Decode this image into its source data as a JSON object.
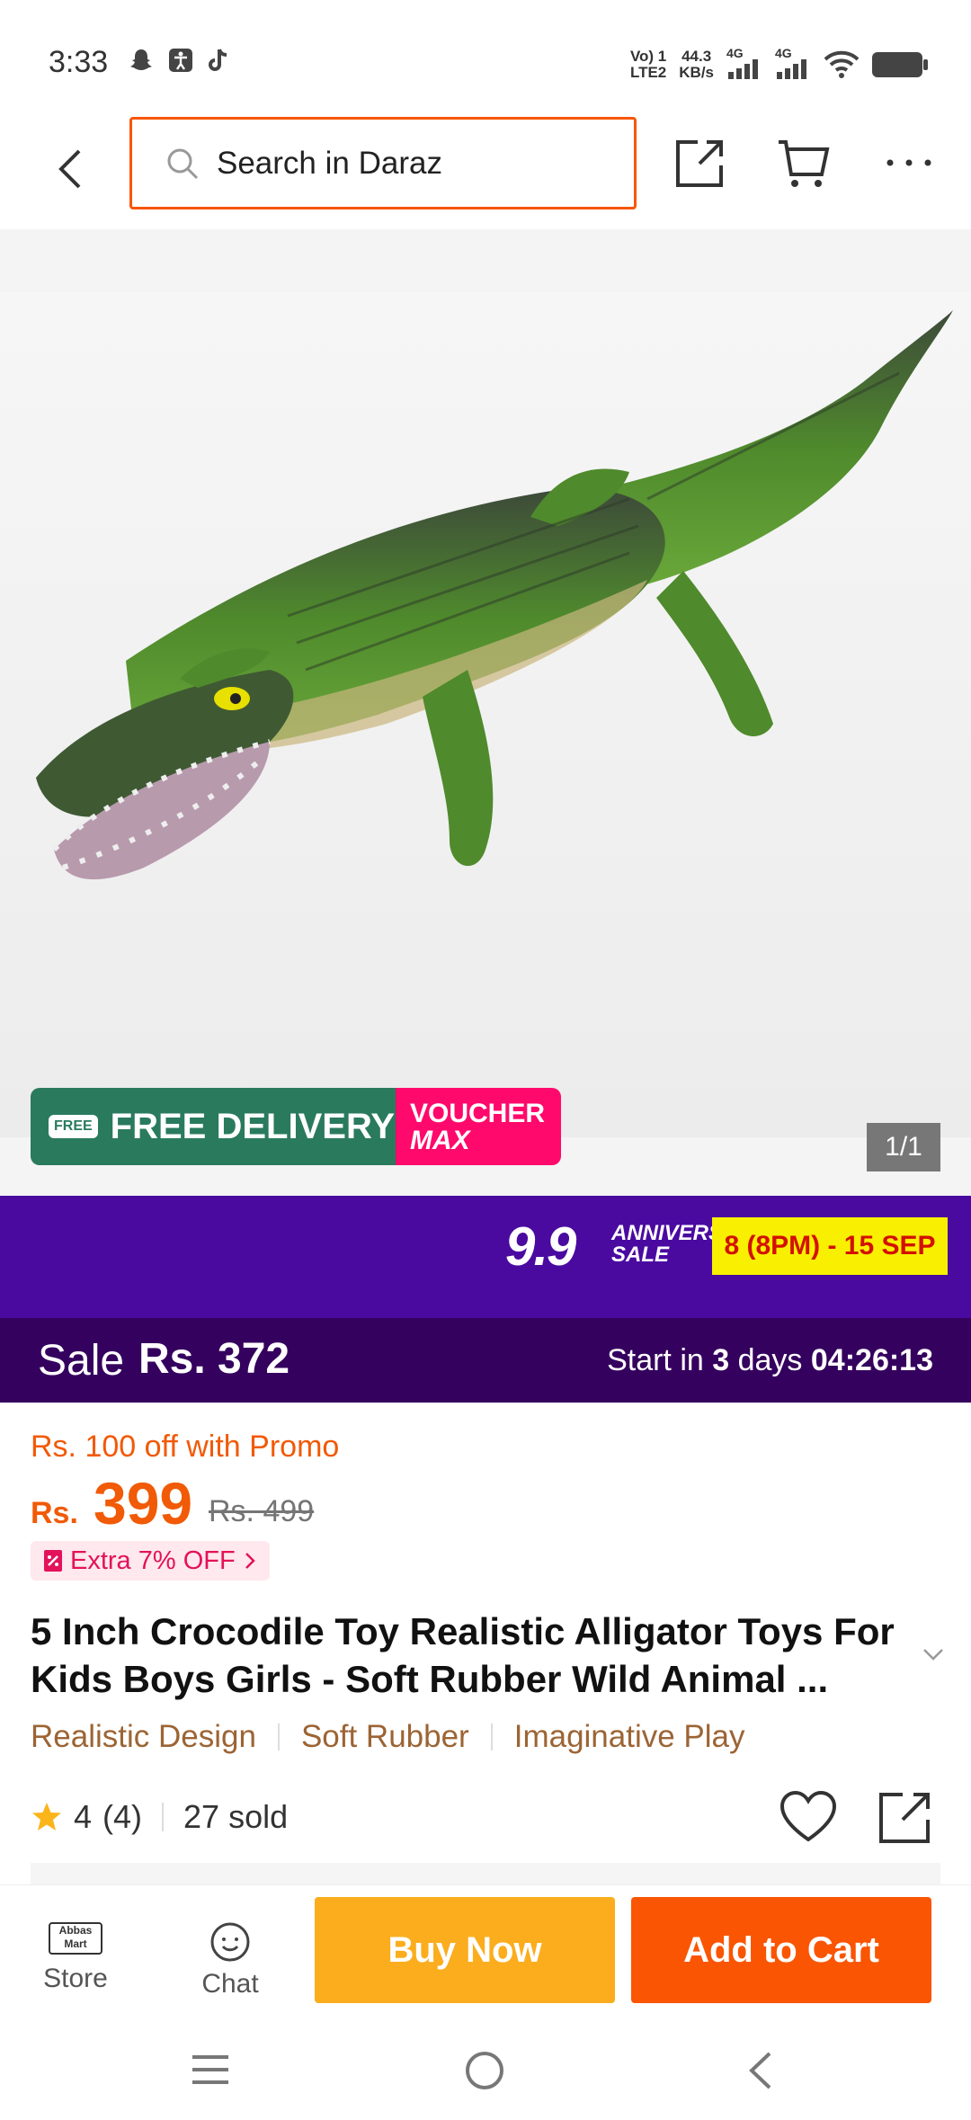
{
  "status_bar": {
    "time": "3:33",
    "network_label_1": "Vo) 1\nLTE2",
    "speed": "44.3\nKB/s",
    "net_4g_a": "4G",
    "net_4g_b": "4G"
  },
  "search": {
    "placeholder": "Search in Daraz"
  },
  "gallery": {
    "counter": "1/1",
    "free_badge_icon_text": "FREE",
    "free_badge_text": "FREE DELIVERY",
    "voucher_text_1": "VOUCHER",
    "voucher_text_2": "MAX"
  },
  "campaign": {
    "big": "9.9",
    "anniv_1": "ANNIVERSARY",
    "anniv_2": "SALE",
    "dates": "8 (8PM) - 15 SEP",
    "sale_label": "Sale",
    "sale_price": "Rs. 372",
    "start_prefix": "Start in ",
    "start_days": "3",
    "start_days_suffix": " days ",
    "start_timer": "04:26:13"
  },
  "product": {
    "promo": "Rs. 100 off with Promo",
    "currency": "Rs.",
    "price": "399",
    "old_price": "Rs. 499",
    "extra_off": "Extra 7% OFF",
    "title": "5 Inch Crocodile Toy Realistic Alligator Toys For Kids Boys Girls - Soft Rubber Wild Animal ...",
    "tags": [
      "Realistic Design",
      "Soft Rubber",
      "Imaginative Play"
    ],
    "rating_value": "4",
    "rating_count": "(4)",
    "sold": "27 sold"
  },
  "bottom_bar": {
    "store_label": "Store",
    "chat_label": "Chat",
    "buy_now": "Buy Now",
    "add_to_cart": "Add to Cart",
    "store_logo_text": "Abbas\nMart"
  },
  "colors": {
    "brand_orange": "#f85606",
    "campaign_purple": "#4a0aa0",
    "sale_bar": "#35015e",
    "buy_now": "#fbad1d",
    "add_to_cart": "#fa5502"
  }
}
